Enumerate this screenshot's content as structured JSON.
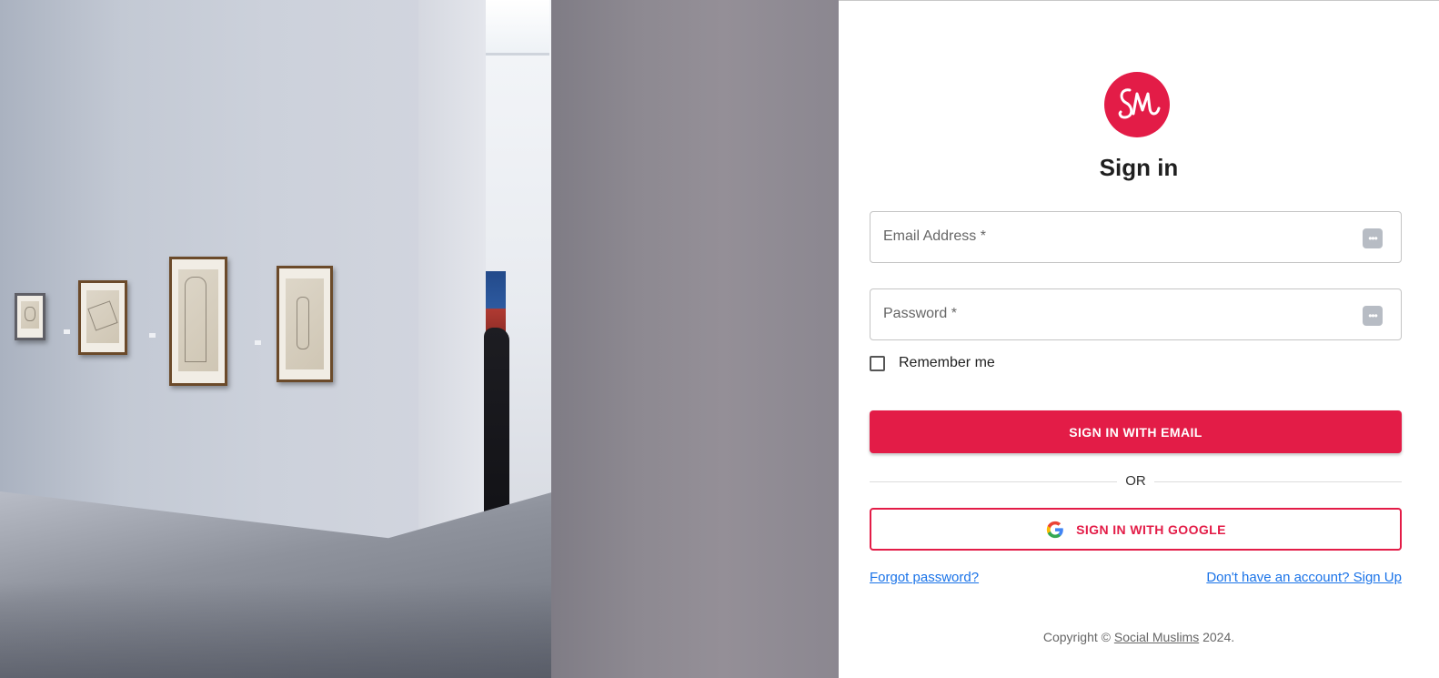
{
  "hero": {
    "description_icon": "gallery-photo"
  },
  "logo": {
    "text": "SM",
    "color": "#e31c47"
  },
  "form": {
    "title": "Sign in",
    "email_label": "Email Address *",
    "password_label": "Password *",
    "remember_label": "Remember me",
    "remember_checked": false,
    "submit_label": "SIGN IN WITH EMAIL",
    "divider_label": "OR",
    "google_label": "SIGN IN WITH GOOGLE",
    "forgot_label": "Forgot password?",
    "signup_label": "Don't have an account? Sign Up"
  },
  "footer": {
    "prefix": "Copyright © ",
    "brand": "Social Muslims",
    "suffix": " 2024."
  },
  "colors": {
    "accent": "#e31c47",
    "link": "#1a73e8"
  }
}
